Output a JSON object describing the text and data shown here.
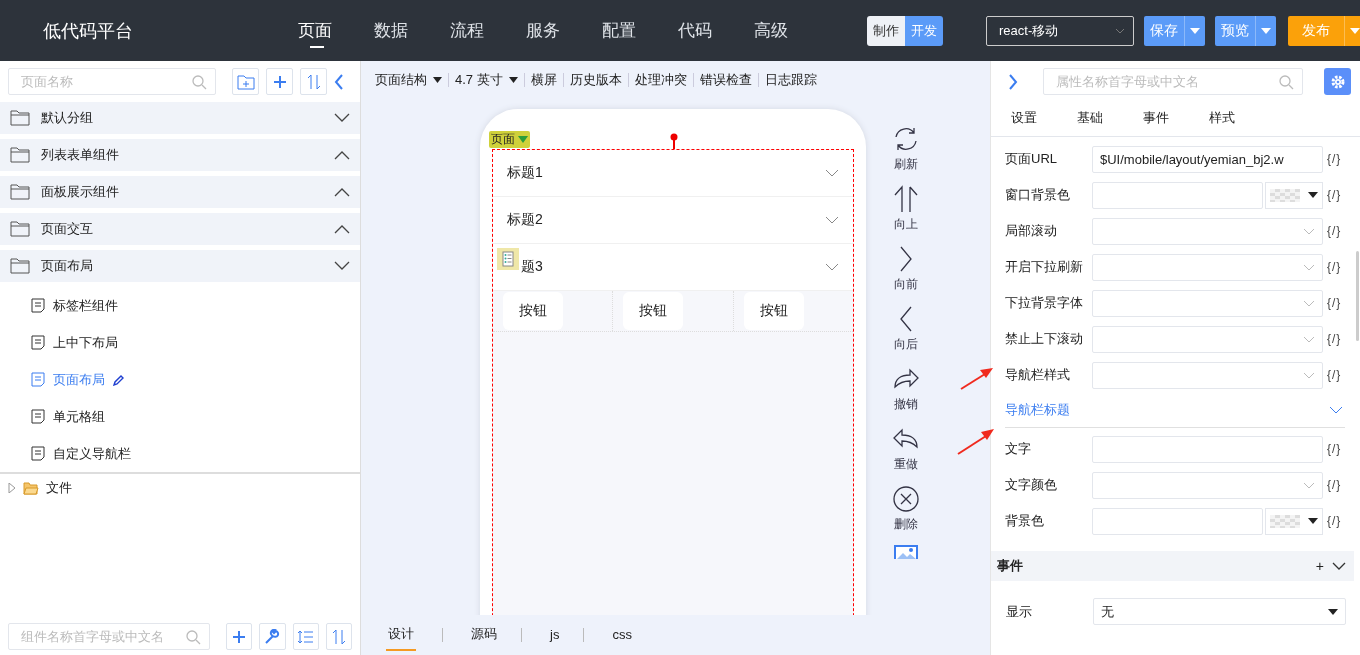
{
  "header": {
    "logo": "低代码平台",
    "nav": [
      {
        "label": "页面",
        "selected": true
      },
      {
        "label": "数据",
        "selected": false
      },
      {
        "label": "流程",
        "selected": false
      },
      {
        "label": "服务",
        "selected": false
      },
      {
        "label": "配置",
        "selected": false
      },
      {
        "label": "代码",
        "selected": false
      },
      {
        "label": "高级",
        "selected": false
      }
    ],
    "mode_toggle": [
      {
        "label": "制作",
        "selected": false
      },
      {
        "label": "开发",
        "selected": true
      }
    ],
    "framework_select": "react-移动",
    "actions": [
      {
        "label": "保存",
        "kind": "primary"
      },
      {
        "label": "预览",
        "kind": "primary"
      },
      {
        "label": "发布",
        "kind": "warning"
      }
    ]
  },
  "left_panel": {
    "search": {
      "placeholder": "页面名称"
    },
    "groups": [
      {
        "label": "默认分组",
        "expanded": true
      },
      {
        "label": "列表表单组件",
        "expanded": false
      },
      {
        "label": "面板展示组件",
        "expanded": false
      },
      {
        "label": "页面交互",
        "expanded": false
      },
      {
        "label": "页面布局",
        "expanded": true,
        "children": [
          {
            "label": "标签栏组件",
            "selected": false
          },
          {
            "label": "上中下布局",
            "selected": false
          },
          {
            "label": "页面布局",
            "selected": true
          },
          {
            "label": "单元格组",
            "selected": false
          },
          {
            "label": "自定义导航栏",
            "selected": false
          }
        ]
      }
    ],
    "file_tree": [
      {
        "label": "文件",
        "expanded": false
      }
    ],
    "component_search": {
      "placeholder": "组件名称首字母或中文名"
    }
  },
  "canvas": {
    "toolbar": [
      {
        "label": "页面结构",
        "kind": "dropdown"
      },
      {
        "label": "4.7 英寸",
        "kind": "dropdown"
      },
      {
        "label": "横屏",
        "kind": "button"
      },
      {
        "label": "历史版本",
        "kind": "button"
      },
      {
        "label": "处理冲突",
        "kind": "button"
      },
      {
        "label": "错误检查",
        "kind": "button"
      },
      {
        "label": "日志跟踪",
        "kind": "button"
      }
    ],
    "page_tag": "页面",
    "accordion": [
      {
        "title": "标题1"
      },
      {
        "title": "标题2"
      },
      {
        "title": "题3"
      }
    ],
    "buttons": [
      "按钮",
      "按钮",
      "按钮"
    ],
    "side_tools": [
      {
        "label": "刷新",
        "kind": "refresh"
      },
      {
        "label": "向上",
        "kind": "up"
      },
      {
        "label": "向前",
        "kind": "forward"
      },
      {
        "label": "向后",
        "kind": "back"
      },
      {
        "label": "撤销",
        "kind": "undo"
      },
      {
        "label": "重做",
        "kind": "redo"
      },
      {
        "label": "删除",
        "kind": "delete"
      }
    ],
    "bottom_tabs": [
      {
        "label": "设计",
        "selected": true
      },
      {
        "label": "源码",
        "selected": false
      },
      {
        "label": "js",
        "selected": false
      },
      {
        "label": "css",
        "selected": false
      }
    ]
  },
  "right_panel": {
    "search": {
      "placeholder": "属性名称首字母或中文名"
    },
    "tabs": [
      {
        "label": "设置",
        "selected": false
      },
      {
        "label": "基础",
        "selected": false
      },
      {
        "label": "事件",
        "selected": false
      },
      {
        "label": "样式",
        "selected": false
      }
    ],
    "properties": [
      {
        "kind": "text",
        "label": "页面URL",
        "value": "$UI/mobile/layout/yemian_bj2.w",
        "binding": "{/}"
      },
      {
        "kind": "color",
        "label": "窗口背景色",
        "binding": "{/}"
      },
      {
        "kind": "select",
        "label": "局部滚动",
        "binding": "{/}"
      },
      {
        "kind": "select",
        "label": "开启下拉刷新",
        "binding": "{/}"
      },
      {
        "kind": "select",
        "label": "下拉背景字体",
        "binding": "{/}"
      },
      {
        "kind": "select",
        "label": "禁止上下滚动",
        "binding": "{/}"
      },
      {
        "kind": "select",
        "label": "导航栏样式",
        "binding": "{/}"
      },
      {
        "kind": "section",
        "label": "导航栏标题"
      },
      {
        "kind": "text",
        "label": "文字",
        "binding": "{/}"
      },
      {
        "kind": "select",
        "label": "文字颜色",
        "binding": "{/}"
      },
      {
        "kind": "color",
        "label": "背景色",
        "binding": "{/}"
      }
    ],
    "events": {
      "title": "事件",
      "add": "+",
      "rows": [
        {
          "label": "显示",
          "value": "无"
        }
      ]
    }
  }
}
